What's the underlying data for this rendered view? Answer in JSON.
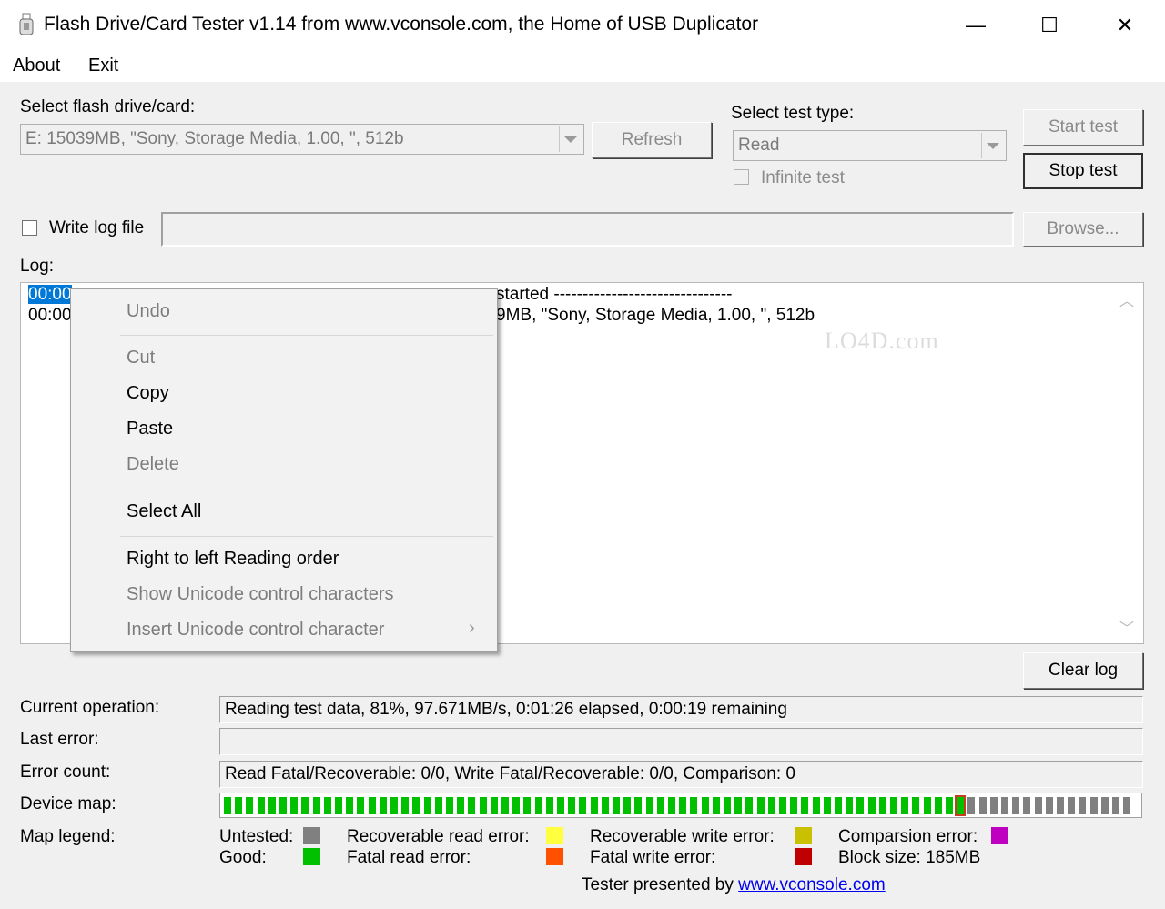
{
  "window": {
    "title": "Flash Drive/Card Tester v1.14 from www.vconsole.com, the Home of USB Duplicator",
    "minimize_glyph": "—",
    "maximize_glyph": "☐",
    "close_glyph": "✕",
    "app_icon": "usb-drive-icon"
  },
  "menu": {
    "items": [
      "About",
      "Exit"
    ]
  },
  "drive": {
    "label": "Select flash drive/card:",
    "selected": "E: 15039MB, \"Sony, Storage Media, 1.00, \", 512b",
    "refresh_label": "Refresh"
  },
  "test": {
    "label": "Select test type:",
    "selected": "Read",
    "infinite_label": "Infinite test",
    "infinite_checked": false
  },
  "buttons": {
    "start": "Start test",
    "stop": "Stop test",
    "browse": "Browse...",
    "clear_log": "Clear log"
  },
  "logfile": {
    "label": "Write log file",
    "checked": false,
    "path": ""
  },
  "log": {
    "label": "Log:",
    "line1_prefix": "00:00",
    "line1_suffix": "started -------------------------------",
    "line2_prefix": "00:00",
    "line2_suffix": "9MB, \"Sony, Storage Media, 1.00, \", 512b"
  },
  "context_menu": {
    "items": [
      {
        "label": "Undo",
        "enabled": false
      },
      {
        "label": "Cut",
        "enabled": false
      },
      {
        "label": "Copy",
        "enabled": true
      },
      {
        "label": "Paste",
        "enabled": true
      },
      {
        "label": "Delete",
        "enabled": false
      },
      {
        "label": "Select All",
        "enabled": true
      },
      {
        "label": "Right to left Reading order",
        "enabled": true
      },
      {
        "label": "Show Unicode control characters",
        "enabled": false
      },
      {
        "label": "Insert Unicode control character",
        "enabled": false
      }
    ],
    "submenu_glyph": "›"
  },
  "status": {
    "current_op_label": "Current operation:",
    "current_op": "Reading test data, 81%, 97.671MB/s, 0:01:26 elapsed, 0:00:19 remaining",
    "last_error_label": "Last error:",
    "last_error": "",
    "error_count_label": "Error count:",
    "error_count": "Read Fatal/Recoverable: 0/0, Write Fatal/Recoverable: 0/0, Comparison: 0",
    "device_map_label": "Device map:",
    "device_map": {
      "total_blocks": 82,
      "good_blocks": 66,
      "current_block": 67
    }
  },
  "legend": {
    "label": "Map legend:",
    "untested": "Untested:",
    "good": "Good:",
    "rec_read": "Recoverable read error:",
    "fatal_read": "Fatal read error:",
    "rec_write": "Recoverable write error:",
    "fatal_write": "Fatal write error:",
    "comparison": "Comparsion error:",
    "block_size": "Block size: 185MB",
    "colors": {
      "untested": "#808080",
      "good": "#00c000",
      "rec_read": "#ffff40",
      "fatal_read": "#ff5000",
      "rec_write": "#c8c000",
      "fatal_write": "#c00000",
      "comparison": "#c000c0",
      "current": "#c04020"
    }
  },
  "footer": {
    "text": "Tester presented by",
    "link": "www.vconsole.com"
  },
  "watermark": "LO4D.com"
}
